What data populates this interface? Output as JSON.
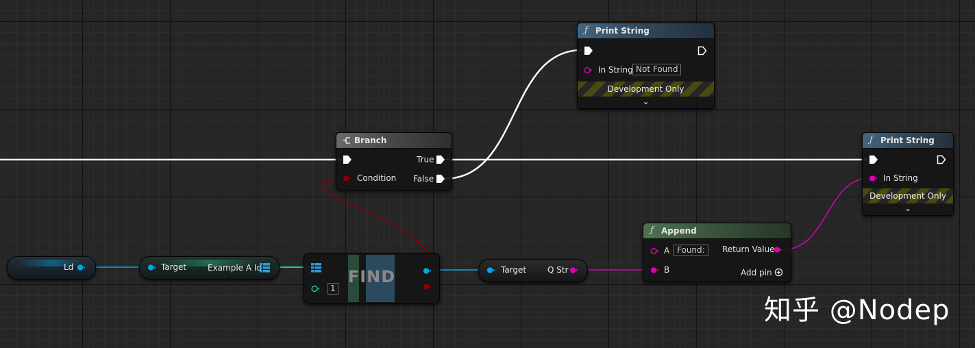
{
  "colors": {
    "exec_wire": "#ffffff",
    "bool_wire": "#8c0000",
    "string_wire": "#e000b4",
    "object_wire": "#00a8e8",
    "array_wire": "#1fc8a0",
    "function_header": "#44657f",
    "branch_header": "#6a6a6a",
    "append_header": "#4f7152"
  },
  "print_string_1": {
    "title": "Print String",
    "icon": "function-icon",
    "in_string_label": "In String",
    "in_string_value": "Not Found",
    "dev_only": "Development Only"
  },
  "branch": {
    "title": "Branch",
    "icon": "branch-icon",
    "condition_label": "Condition",
    "true_label": "True",
    "false_label": "False"
  },
  "print_string_2": {
    "title": "Print String",
    "icon": "function-icon",
    "in_string_label": "In String",
    "dev_only": "Development Only"
  },
  "append": {
    "title": "Append",
    "icon": "function-icon",
    "a_label": "A",
    "a_value": "Found:",
    "b_label": "B",
    "return_label": "Return Value",
    "add_pin_label": "Add pin"
  },
  "ld_node": {
    "label": "Ld"
  },
  "get_ids_node": {
    "target_label": "Target",
    "output_label": "Example A Id"
  },
  "find_node": {
    "title": "FIND",
    "index_value": "1"
  },
  "to_string_node": {
    "target_label": "Target",
    "output_label": "Q Str"
  },
  "watermark": {
    "text": "知乎 @Nodep"
  }
}
